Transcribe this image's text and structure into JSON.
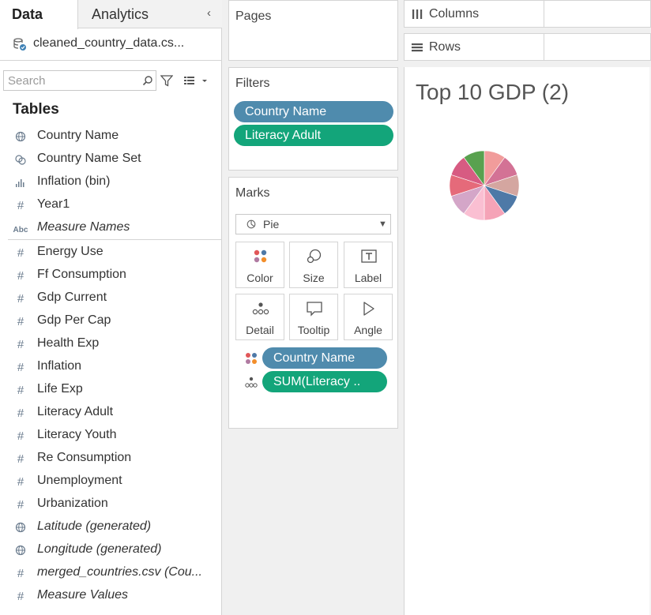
{
  "left_pane": {
    "tabs": [
      {
        "label": "Data",
        "active": true
      },
      {
        "label": "Analytics",
        "active": false
      }
    ],
    "collapse_icon": "chevron-left-icon",
    "datasource": {
      "name": "cleaned_country_data.cs...",
      "icon": "database-icon"
    },
    "search": {
      "placeholder": "Search",
      "value": ""
    },
    "tables_heading": "Tables",
    "fields_dimensions": [
      {
        "label": "Country Name",
        "icon": "globe-icon",
        "italic": false
      },
      {
        "label": "Country Name Set",
        "icon": "set-icon",
        "italic": false
      },
      {
        "label": "Inflation (bin)",
        "icon": "histogram-icon",
        "italic": false
      },
      {
        "label": "Year1",
        "icon": "hash-icon",
        "italic": false
      },
      {
        "label": "Measure Names",
        "icon": "abc-icon",
        "italic": true
      }
    ],
    "fields_measures": [
      {
        "label": "Energy Use",
        "icon": "hash-icon",
        "italic": false
      },
      {
        "label": "Ff Consumption",
        "icon": "hash-icon",
        "italic": false
      },
      {
        "label": "Gdp Current",
        "icon": "hash-icon",
        "italic": false
      },
      {
        "label": "Gdp Per Cap",
        "icon": "hash-icon",
        "italic": false
      },
      {
        "label": "Health Exp",
        "icon": "hash-icon",
        "italic": false
      },
      {
        "label": "Inflation",
        "icon": "hash-icon",
        "italic": false
      },
      {
        "label": "Life Exp",
        "icon": "hash-icon",
        "italic": false
      },
      {
        "label": "Literacy Adult",
        "icon": "hash-icon",
        "italic": false
      },
      {
        "label": "Literacy Youth",
        "icon": "hash-icon",
        "italic": false
      },
      {
        "label": "Re Consumption",
        "icon": "hash-icon",
        "italic": false
      },
      {
        "label": "Unemployment",
        "icon": "hash-icon",
        "italic": false
      },
      {
        "label": "Urbanization",
        "icon": "hash-icon",
        "italic": false
      },
      {
        "label": "Latitude (generated)",
        "icon": "globe-icon",
        "italic": true
      },
      {
        "label": "Longitude (generated)",
        "icon": "globe-icon",
        "italic": true
      },
      {
        "label": "merged_countries.csv (Cou...",
        "icon": "hash-icon",
        "italic": true
      },
      {
        "label": "Measure Values",
        "icon": "hash-icon",
        "italic": true
      }
    ]
  },
  "pages": {
    "title": "Pages"
  },
  "filters": {
    "title": "Filters",
    "pills": [
      {
        "label": "Country Name",
        "color": "#4f8bad"
      },
      {
        "label": "Literacy Adult",
        "color": "#13a57a"
      }
    ]
  },
  "marks": {
    "title": "Marks",
    "mark_type": "Pie",
    "buttons": [
      {
        "label": "Color",
        "icon": "color-icon"
      },
      {
        "label": "Size",
        "icon": "size-icon"
      },
      {
        "label": "Label",
        "icon": "label-icon"
      },
      {
        "label": "Detail",
        "icon": "detail-icon"
      },
      {
        "label": "Tooltip",
        "icon": "tooltip-icon"
      },
      {
        "label": "Angle",
        "icon": "angle-icon"
      }
    ],
    "pills": [
      {
        "label": "Country Name",
        "icon": "color-icon",
        "color": "#4f8bad"
      },
      {
        "label": "SUM(Literacy ..",
        "icon": "detail-icon",
        "color": "#13a57a"
      }
    ]
  },
  "shelves": {
    "columns_label": "Columns",
    "rows_label": "Rows"
  },
  "view": {
    "title": "Top 10 GDP (2)"
  },
  "chart_data": {
    "type": "pie",
    "title": "Top 10 GDP (2)",
    "slices": [
      {
        "value": 10,
        "color": "#f19c9b"
      },
      {
        "value": 10,
        "color": "#d37295"
      },
      {
        "value": 10,
        "color": "#d4a6a0"
      },
      {
        "value": 10,
        "color": "#4e79a7"
      },
      {
        "value": 10,
        "color": "#f5a3b7"
      },
      {
        "value": 10,
        "color": "#fabfd2"
      },
      {
        "value": 10,
        "color": "#d4a6c8"
      },
      {
        "value": 10,
        "color": "#e56a7a"
      },
      {
        "value": 10,
        "color": "#d75b82"
      },
      {
        "value": 10,
        "color": "#59a14f"
      }
    ]
  }
}
